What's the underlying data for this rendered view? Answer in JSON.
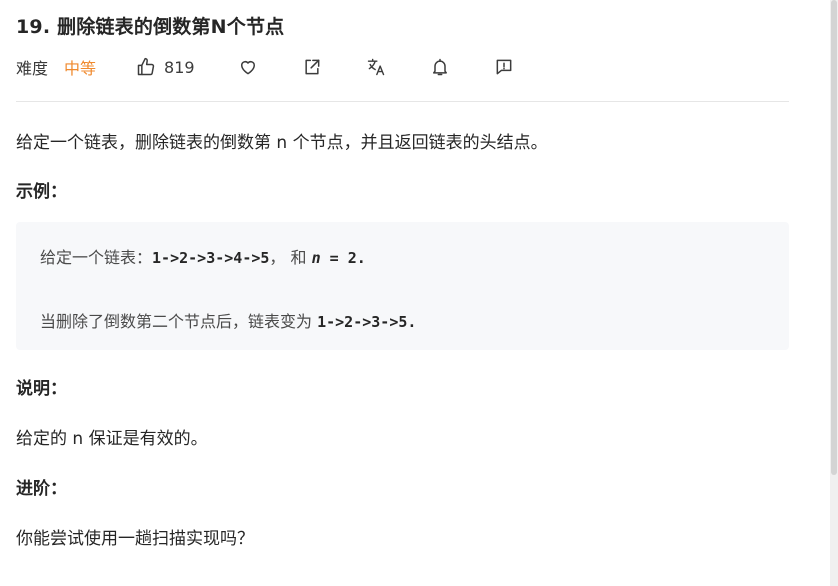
{
  "problem": {
    "title": "19. 删除链表的倒数第N个节点",
    "difficulty_label": "难度",
    "difficulty_value": "中等",
    "likes": "819",
    "accent_color": "#f08a2e"
  },
  "content": {
    "description": "给定一个链表，删除链表的倒数第 n 个节点，并且返回链表的头结点。",
    "example_heading": "示例：",
    "example": {
      "line1_text": "给定一个链表：",
      "line1_code": "1->2->3->4->5",
      "line1_and": "， 和 ",
      "line1_var": "n",
      "line1_eq": " = 2.",
      "line2_text": "当删除了倒数第二个节点后，链表变为 ",
      "line2_code": "1->2->3->5."
    },
    "note_heading": "说明：",
    "note_text": "给定的 n 保证是有效的。",
    "advanced_heading": "进阶：",
    "advanced_text": "你能尝试使用一趟扫描实现吗？"
  },
  "icons": [
    "thumbs-up-icon",
    "heart-icon",
    "share-icon",
    "translate-icon",
    "bell-icon",
    "feedback-icon"
  ]
}
